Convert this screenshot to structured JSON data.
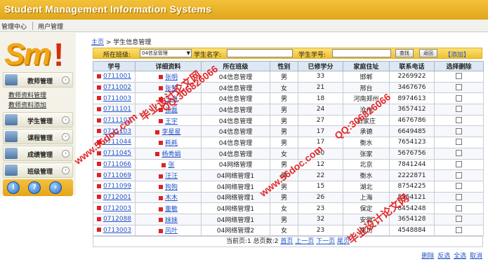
{
  "app": {
    "title": "Student Management Information Systems"
  },
  "menubar": {
    "items": [
      {
        "label": "管理中心"
      },
      {
        "label": "用户管理"
      }
    ]
  },
  "sidebar": {
    "logo": "Sm!",
    "sections": [
      {
        "label": "教师管理",
        "icon": "teacher-icon",
        "sublinks": [
          "教师资料管理",
          "教师资料添加"
        ]
      },
      {
        "label": "学生管理",
        "icon": "student-icon"
      },
      {
        "label": "课程管理",
        "icon": "course-icon"
      },
      {
        "label": "成绩管理",
        "icon": "score-icon"
      },
      {
        "label": "班级管理",
        "icon": "class-icon"
      }
    ],
    "round_buttons": [
      {
        "glyph": "!"
      },
      {
        "glyph": "?"
      },
      {
        "glyph": "›"
      }
    ]
  },
  "breadcrumb": {
    "home": "主页",
    "sep": " > ",
    "current": "学生信息管理"
  },
  "search": {
    "class_label": "所在班级:",
    "class_value": "04信息管理",
    "name_label": "学生名字:",
    "name_value": "",
    "id_label": "学生学号:",
    "id_value": "",
    "query_button": "查找",
    "back_button": "返回",
    "add_link": "【添加】"
  },
  "table": {
    "headers": [
      "学号",
      "详细资料",
      "所在班级",
      "性别",
      "已修学分",
      "家庭住址",
      "联系电话",
      "选择删除"
    ],
    "rows": [
      {
        "id": "0711001",
        "name": "张明",
        "class": "04信息管理",
        "sex": "男",
        "credits": "33",
        "address": "邯郸",
        "phone": "2269922"
      },
      {
        "id": "0711002",
        "name": "张梦",
        "class": "04信息管理",
        "sex": "女",
        "credits": "21",
        "address": "邢台",
        "phone": "3467676"
      },
      {
        "id": "0711003",
        "name": "王海",
        "class": "04信息管理",
        "sex": "男",
        "credits": "18",
        "address": "河南郑州",
        "phone": "8974613"
      },
      {
        "id": "0711101",
        "name": "张磊",
        "class": "04信息管理",
        "sex": "男",
        "credits": "24",
        "address": "沧州",
        "phone": "3657412"
      },
      {
        "id": "0711102",
        "name": "王宇",
        "class": "04信息管理",
        "sex": "男",
        "credits": "27",
        "address": "石家庄",
        "phone": "4676786"
      },
      {
        "id": "0711103",
        "name": "李星星",
        "class": "04信息管理",
        "sex": "男",
        "credits": "17",
        "address": "承德",
        "phone": "6649485"
      },
      {
        "id": "0711044",
        "name": "耗耗",
        "class": "04信息管理",
        "sex": "男",
        "credits": "17",
        "address": "衡水",
        "phone": "7654123"
      },
      {
        "id": "0711045",
        "name": "杨秀娟",
        "class": "04信息管理",
        "sex": "女",
        "credits": "20",
        "address": "张家",
        "phone": "5676756"
      },
      {
        "id": "0711066",
        "name": "张",
        "class": "04网络管理",
        "sex": "男",
        "credits": "12",
        "address": "北京",
        "phone": "7841244"
      },
      {
        "id": "0711069",
        "name": "汪汪",
        "class": "04网络管理1",
        "sex": "男",
        "credits": "22",
        "address": "衡水",
        "phone": "2222871"
      },
      {
        "id": "0711099",
        "name": "狗狗",
        "class": "04网络管理1",
        "sex": "男",
        "credits": "15",
        "address": "湖北",
        "phone": "8754225"
      },
      {
        "id": "0712001",
        "name": "木木",
        "class": "04网络管理1",
        "sex": "男",
        "credits": "26",
        "address": "上海",
        "phone": "5554121"
      },
      {
        "id": "0712003",
        "name": "董敏",
        "class": "04网络管理1",
        "sex": "女",
        "credits": "23",
        "address": "保定",
        "phone": "8454248"
      },
      {
        "id": "0712088",
        "name": "妹妹",
        "class": "04网络管理1",
        "sex": "男",
        "credits": "32",
        "address": "安徽",
        "phone": "3654128"
      },
      {
        "id": "0713003",
        "name": "风叶",
        "class": "04网络管理2",
        "sex": "女",
        "credits": "23",
        "address": "廊坊",
        "phone": "4548884"
      }
    ]
  },
  "pager": {
    "current_label": "当前页:",
    "current": "1",
    "total_label": "总页数:",
    "total": "2",
    "first": "首页",
    "prev": "上一页",
    "next": "下一页",
    "last": "尾页"
  },
  "bottom_actions": [
    "删除",
    "反选",
    "全选",
    "取消"
  ],
  "watermarks": [
    {
      "text": "毕业设计论文网",
      "css": "left:190px;top:126px;font-size:15px;transform:rotate(-38deg);"
    },
    {
      "text": "QQ:306826066",
      "css": "left:222px;top:118px;font-size:14px;transform:rotate(-38deg);"
    },
    {
      "text": "www.56doc.com",
      "css": "left:96px;top:190px;font-size:14px;transform:rotate(-38deg);"
    },
    {
      "text": "www.56doc.com",
      "css": "left:360px;top:236px;font-size:14px;transform:rotate(-38deg);"
    },
    {
      "text": "QQ:306826066",
      "css": "left:468px;top:158px;font-size:14px;transform:rotate(-38deg);"
    },
    {
      "text": "毕业设计论文网",
      "css": "left:486px;top:302px;font-size:15px;transform:rotate(-38deg);"
    }
  ]
}
